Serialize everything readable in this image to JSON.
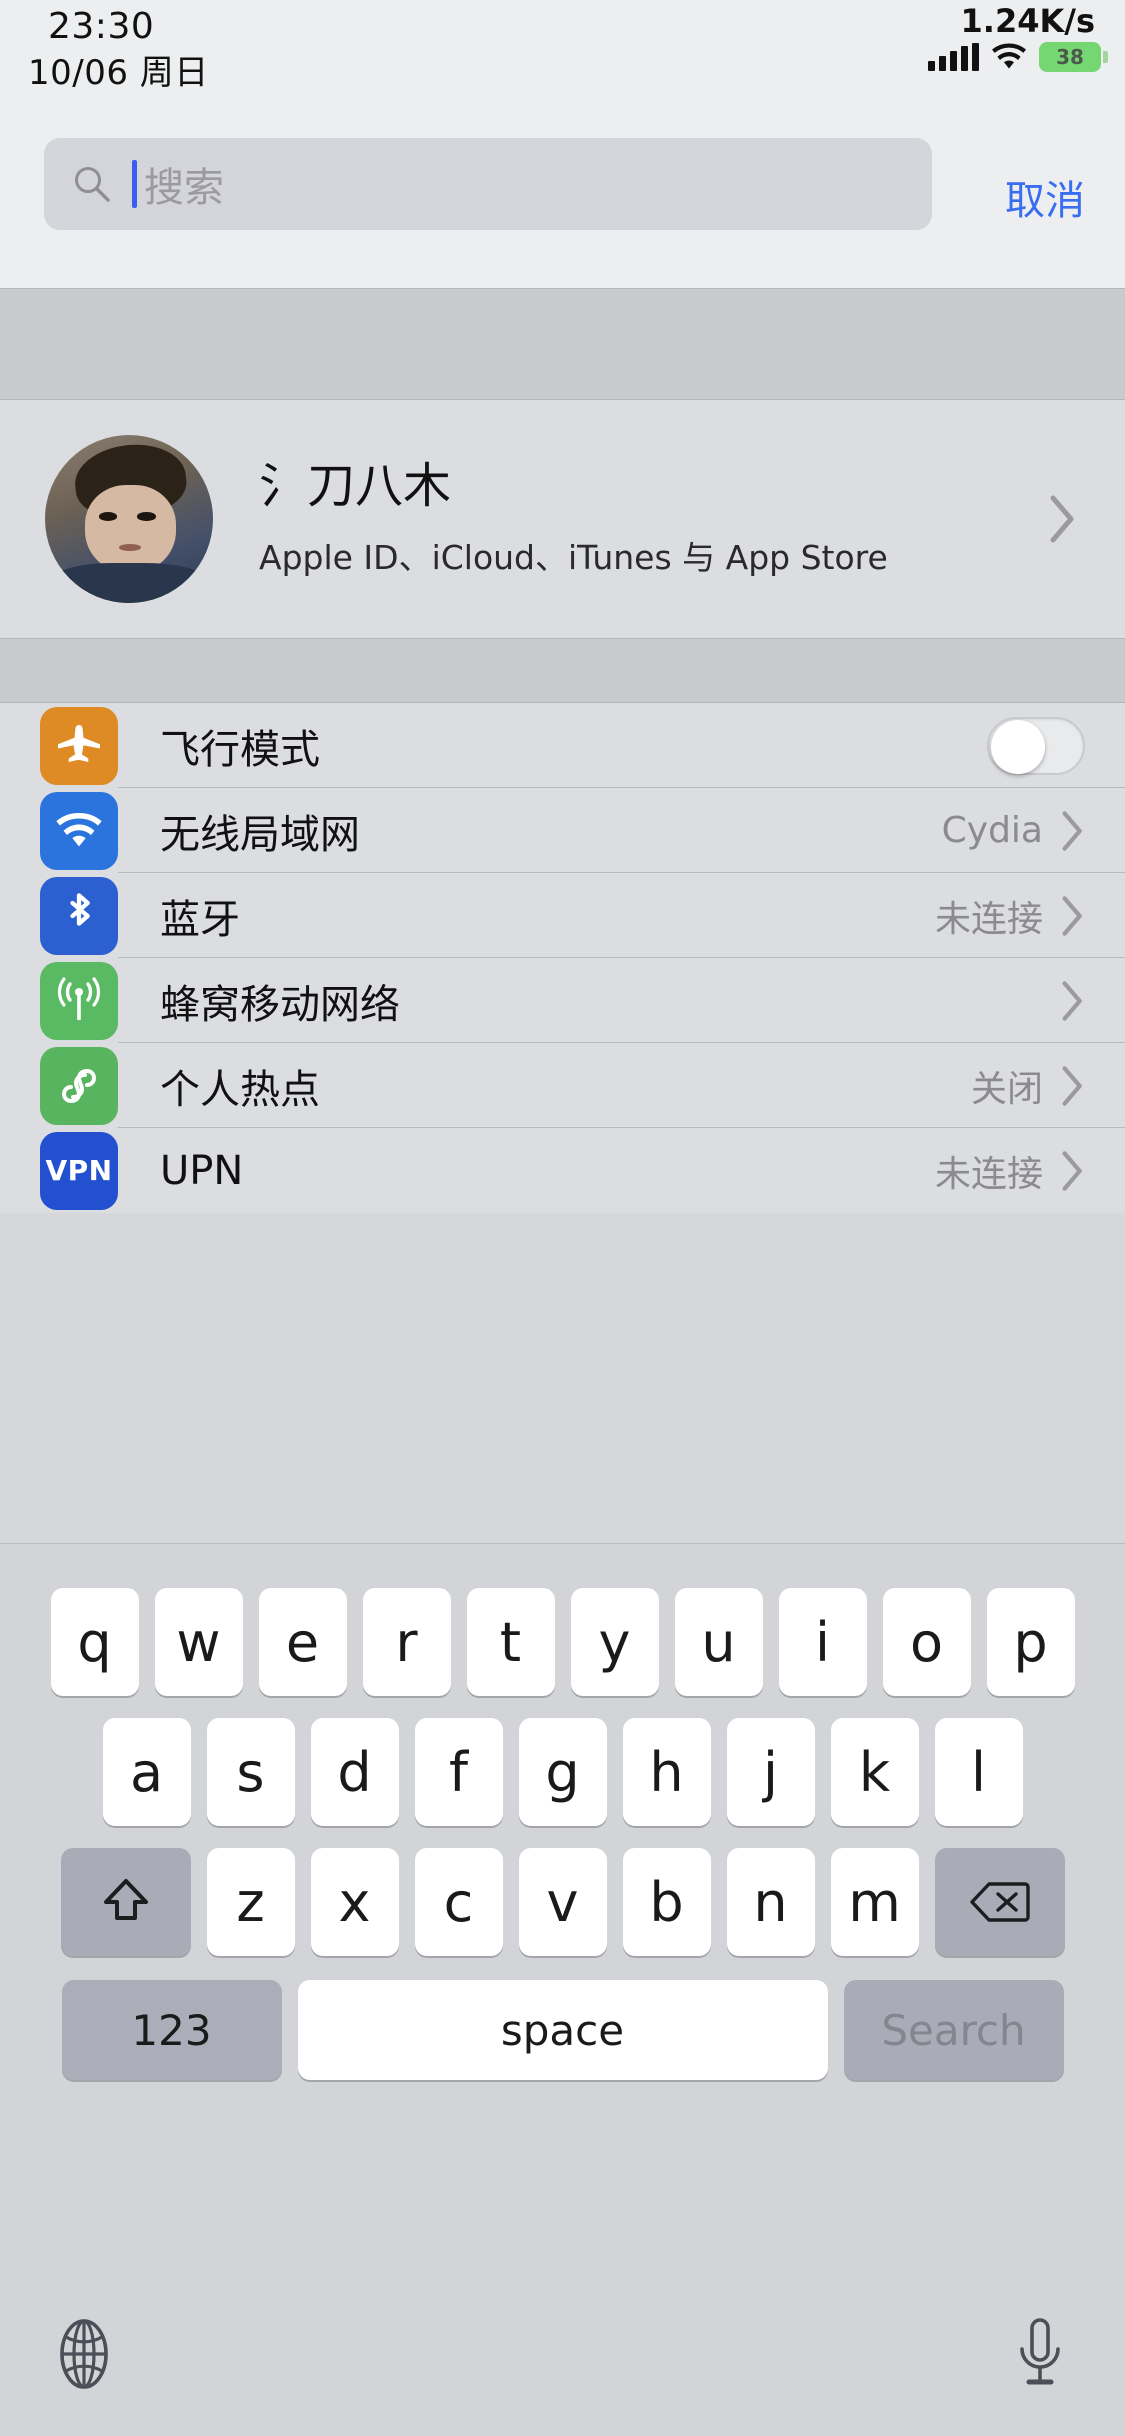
{
  "status_bar": {
    "time": "23:30",
    "date": "10/06 周日",
    "network_speed": "1.24K/s",
    "battery_level": "38",
    "signal_icon": "signal-bars-icon",
    "wifi_icon": "wifi-icon",
    "battery_color": "#76d672"
  },
  "search": {
    "placeholder": "搜索",
    "value": "",
    "icon": "search-icon",
    "cancel_label": "取消",
    "cancel_color": "#3a6ef0"
  },
  "profile": {
    "name": "氵刀八木",
    "subtitle": "Apple ID、iCloud、iTunes 与 App Store",
    "avatar": "user-avatar",
    "chevron": "chevron-right-icon"
  },
  "settings": {
    "rows": [
      {
        "label": "飞行模式",
        "icon": "airplane-icon",
        "icon_color": "#de8a25",
        "control": "toggle",
        "toggle_on": false,
        "value": ""
      },
      {
        "label": "无线局域网",
        "icon": "wifi-icon",
        "icon_color": "#2c74dd",
        "control": "chevron",
        "value": "Cydia"
      },
      {
        "label": "蓝牙",
        "icon": "bluetooth-icon",
        "icon_color": "#2c5fd0",
        "control": "chevron",
        "value": "未连接"
      },
      {
        "label": "蜂窝移动网络",
        "icon": "cellular-icon",
        "icon_color": "#5ab963",
        "control": "chevron",
        "value": ""
      },
      {
        "label": "个人热点",
        "icon": "hotspot-icon",
        "icon_color": "#58b45f",
        "control": "chevron",
        "value": "关闭"
      },
      {
        "label": "UPN",
        "icon": "vpn-icon",
        "icon_color": "#2350cf",
        "icon_text": "VPN",
        "control": "chevron",
        "value": "未连接"
      }
    ]
  },
  "keyboard": {
    "row1": [
      "q",
      "w",
      "e",
      "r",
      "t",
      "y",
      "u",
      "i",
      "o",
      "p"
    ],
    "row2": [
      "a",
      "s",
      "d",
      "f",
      "g",
      "h",
      "j",
      "k",
      "l"
    ],
    "row3": [
      "z",
      "x",
      "c",
      "v",
      "b",
      "n",
      "m"
    ],
    "shift_icon": "shift-up-arrow-icon",
    "backspace_icon": "backspace-delete-icon",
    "numbers_label": "123",
    "space_label": "space",
    "return_label": "Search",
    "globe_icon": "globe-language-icon",
    "mic_icon": "microphone-icon"
  }
}
